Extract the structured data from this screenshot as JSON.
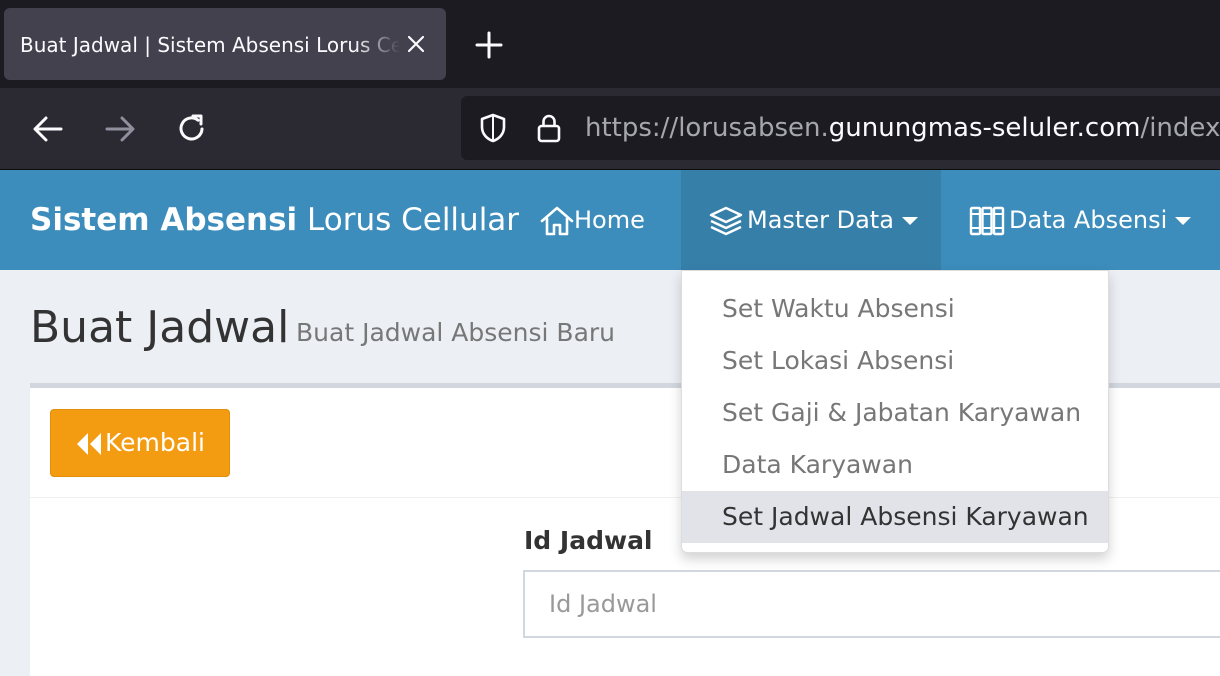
{
  "browser": {
    "tab_title": "Buat Jadwal | Sistem Absensi Lorus Cellular",
    "url_prefix": "https://lorusabsen.",
    "url_host": "gunungmas-seluler.com",
    "url_suffix": "/index.p"
  },
  "navbar": {
    "brand_bold": "Sistem Absensi",
    "brand_rest": " Lorus Cellular",
    "home_label": "Home",
    "master_data_label": "Master Data",
    "data_absensi_label": "Data Absensi",
    "color": "#3c8dbc"
  },
  "dropdown": {
    "items": [
      {
        "label": "Set Waktu Absensi"
      },
      {
        "label": "Set Lokasi Absensi"
      },
      {
        "label": "Set Gaji & Jabatan Karyawan"
      },
      {
        "label": "Data Karyawan"
      },
      {
        "label": "Set Jadwal Absensi Karyawan"
      }
    ]
  },
  "page": {
    "title": "Buat Jadwal",
    "subtitle": "Buat Jadwal Absensi Baru"
  },
  "form": {
    "back_label": "Kembali",
    "id_label": "Id Jadwal",
    "id_placeholder": "Id Jadwal",
    "id_value": ""
  }
}
